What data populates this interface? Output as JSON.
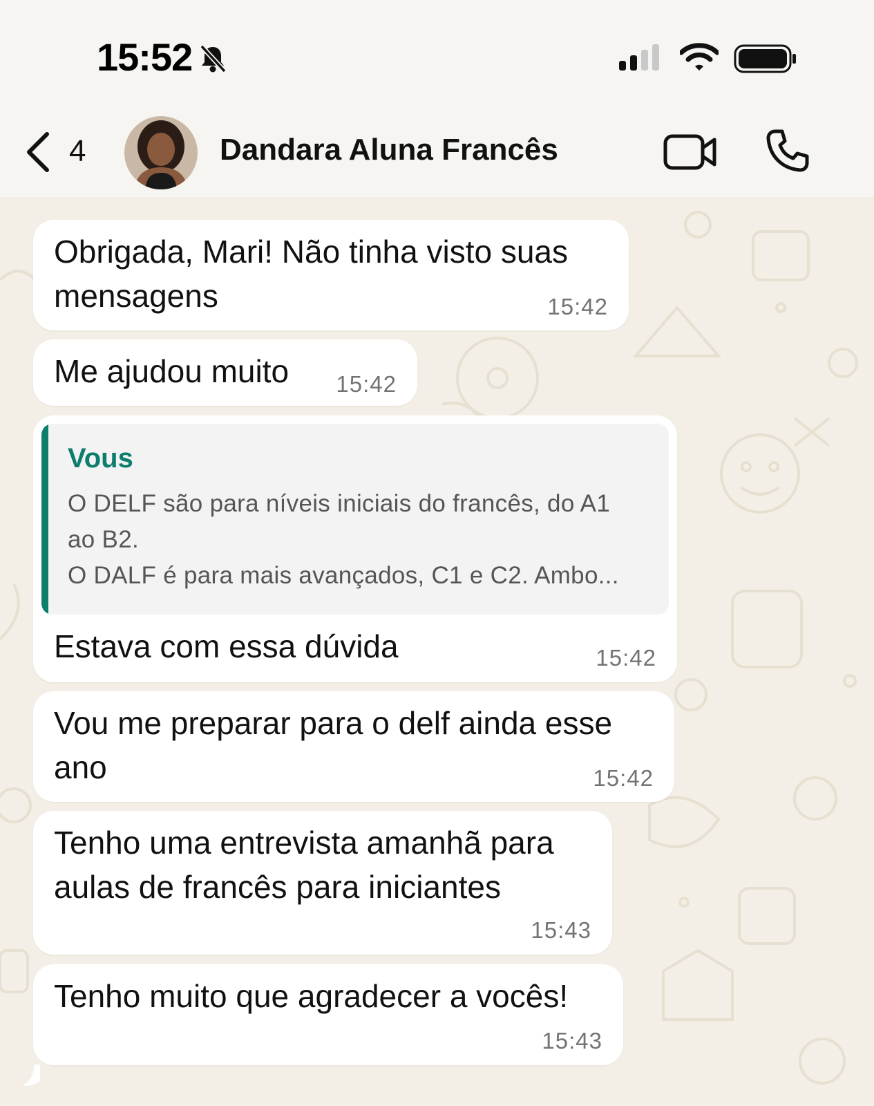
{
  "status_bar": {
    "time": "15:52"
  },
  "header": {
    "back_count": "4",
    "contact_name": "Dandara Aluna Francês"
  },
  "messages": [
    {
      "lines": [
        "Obrigada, Mari! Não tinha visto suas",
        "mensagens"
      ],
      "time": "15:42"
    },
    {
      "lines": [
        "Me ajudou muito"
      ],
      "time": "15:42"
    },
    {
      "quote": {
        "author": "Vous",
        "lines": [
          "O DELF são para níveis iniciais do francês, do A1",
          "ao B2.",
          "O DALF é para mais avançados, C1 e C2. Ambo..."
        ]
      },
      "lines": [
        "Estava com essa dúvida"
      ],
      "time": "15:42"
    },
    {
      "lines": [
        "Vou me preparar para o delf ainda esse",
        "ano"
      ],
      "time": "15:42"
    },
    {
      "lines": [
        "Tenho uma entrevista amanhã para",
        "aulas de francês para iniciantes"
      ],
      "time": "15:43"
    },
    {
      "lines": [
        "Tenho muito que agradecer a vocês!"
      ],
      "time": "15:43"
    }
  ],
  "colors": {
    "quote_accent": "#0d7d6c",
    "chat_background": "#f3efe6",
    "bubble": "#ffffff"
  },
  "icons": [
    "bell-slash-icon",
    "signal-icon",
    "wifi-icon",
    "battery-icon",
    "chevron-left-icon",
    "video-camera-icon",
    "phone-icon"
  ]
}
